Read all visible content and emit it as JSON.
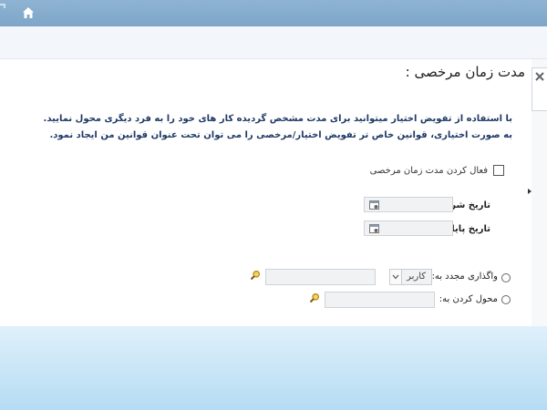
{
  "form": {
    "title": "مدت زمان مرخصی :",
    "description_line1": "با استفاده از تفویض اختیار میتوانید برای مدت مشخص گردیده کار های خود را به فرد دیگری محول نمایید.",
    "description_line2": "به صورت اختیاری، قوانین خاص تر تفویض اختیار/مرخصی را می توان تحت عنوان قوانین من ایجاد نمود.",
    "enable_leave_label": "فعال کردن مدت زمان مرخصی",
    "start_date_label": "تاریخ شروع",
    "end_date_label": "تاریخ پایان",
    "reassign_label": "واگذاری مجدد به:",
    "reassign_type_value": "کاربر",
    "delegate_label": "محول کردن به:"
  },
  "icons": {
    "home": "home-icon",
    "close": "close-icon",
    "calendar": "calendar-icon",
    "search": "search-icon"
  },
  "colors": {
    "header": "#7ea6c8",
    "description_text": "#1f3a66",
    "footer": "#b5dcf3"
  }
}
